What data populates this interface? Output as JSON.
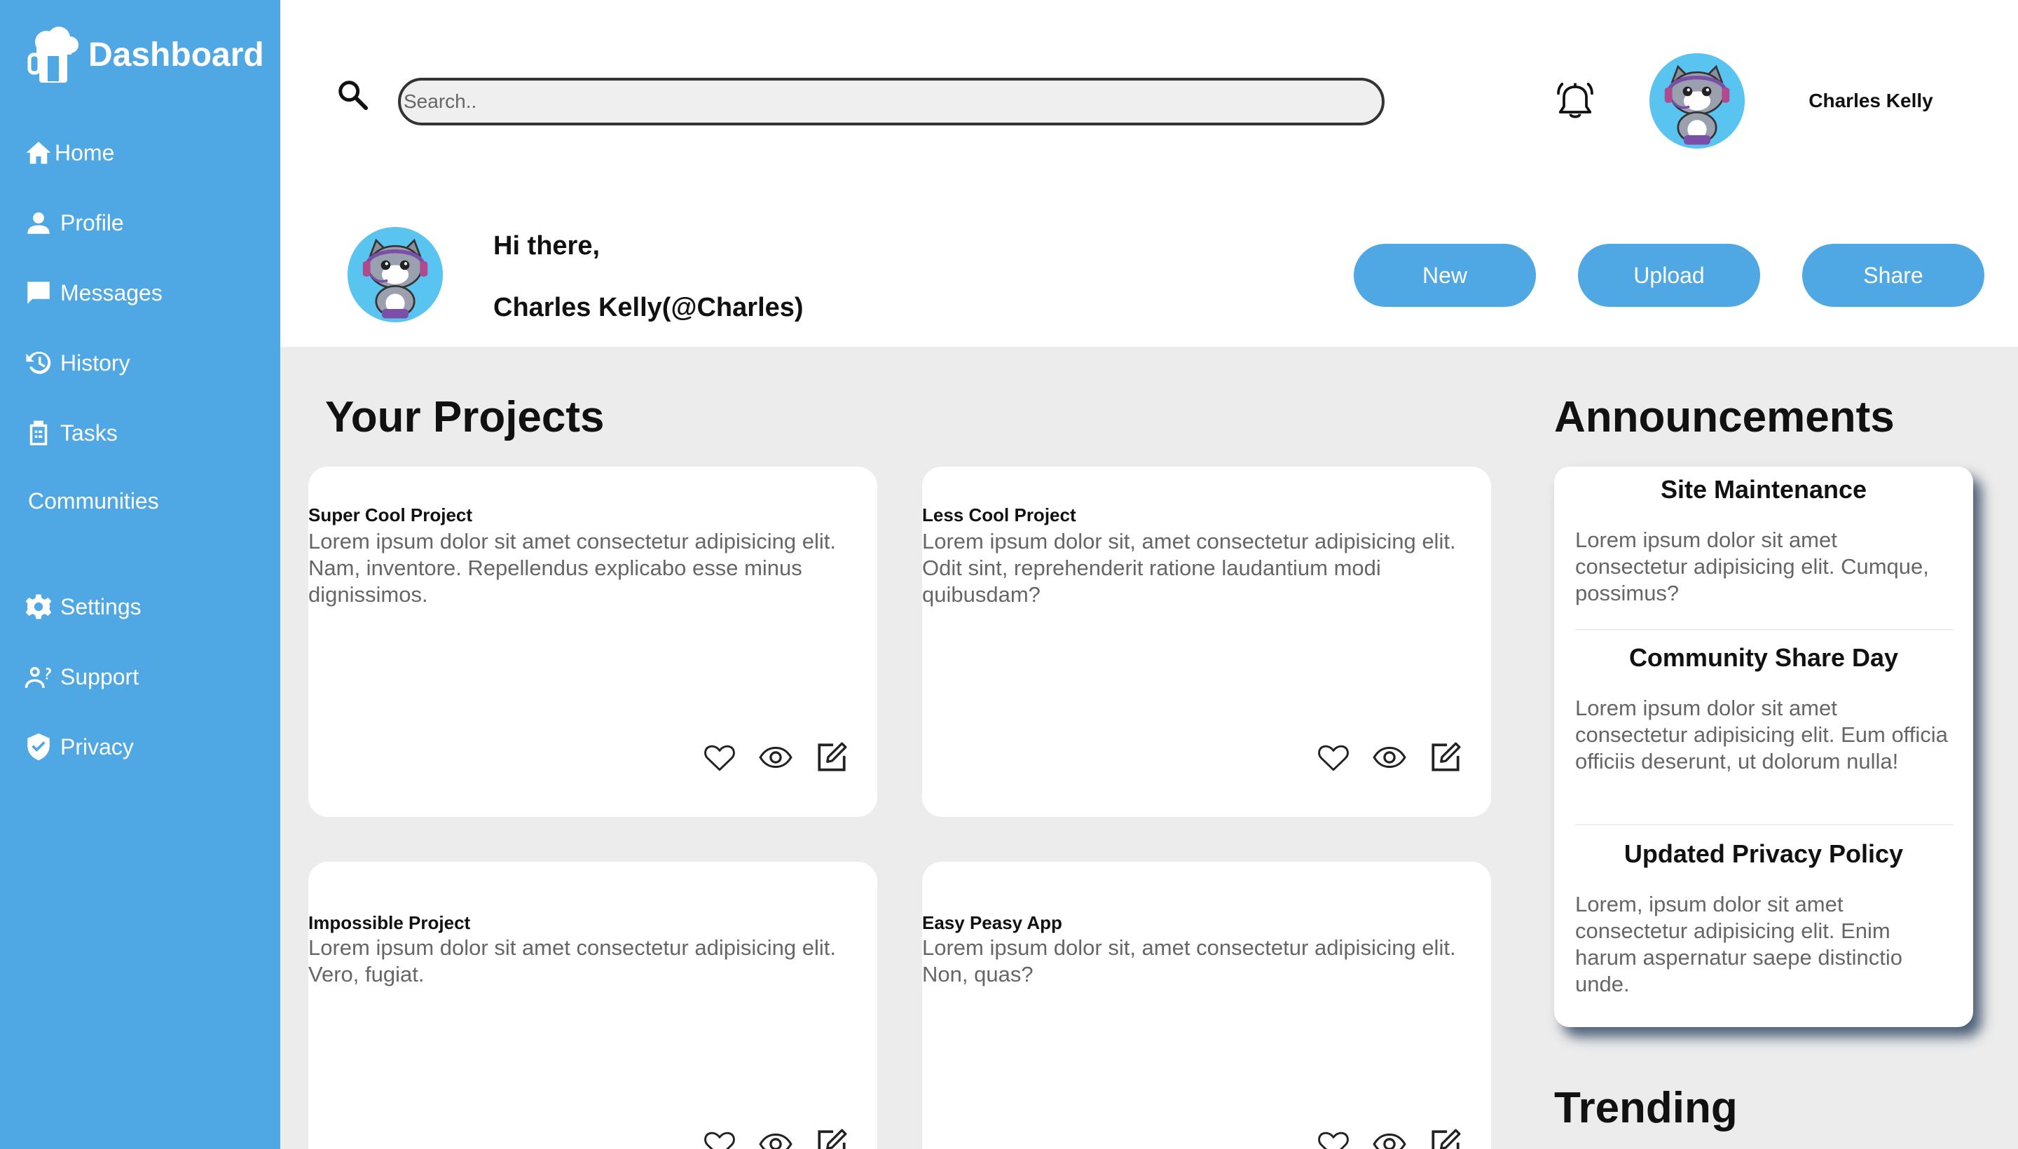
{
  "sidebar": {
    "brand": "Dashboard",
    "items": [
      {
        "label": "Home"
      },
      {
        "label": "Profile"
      },
      {
        "label": "Messages"
      },
      {
        "label": "History"
      },
      {
        "label": "Tasks"
      },
      {
        "label": "Communities"
      },
      {
        "label": "Settings"
      },
      {
        "label": "Support"
      },
      {
        "label": "Privacy"
      }
    ]
  },
  "header": {
    "search_placeholder": "Search..",
    "username": "Charles Kelly",
    "greeting": "Hi there,",
    "handle": "Charles Kelly(@Charles)",
    "buttons": {
      "new": "New",
      "upload": "Upload",
      "share": "Share"
    }
  },
  "projects": {
    "title": "Your Projects",
    "items": [
      {
        "title": "Super Cool Project",
        "body": "Lorem ipsum dolor sit amet consectetur adipisicing elit. Nam, inventore. Repellendus explicabo esse minus dignissimos."
      },
      {
        "title": "Less Cool Project",
        "body": "Lorem ipsum dolor sit, amet consectetur adipisicing elit. Odit sint, reprehenderit ratione laudantium modi quibusdam?"
      },
      {
        "title": "Impossible Project",
        "body": "Lorem ipsum dolor sit amet consectetur adipisicing elit. Vero, fugiat."
      },
      {
        "title": "Easy Peasy App",
        "body": "Lorem ipsum dolor sit, amet consectetur adipisicing elit. Non, quas?"
      }
    ]
  },
  "announcements": {
    "title": "Announcements",
    "items": [
      {
        "title": "Site Maintenance",
        "body": "Lorem ipsum dolor sit amet consectetur adipisicing elit. Cumque, possimus?"
      },
      {
        "title": "Community Share Day",
        "body": "Lorem ipsum dolor sit amet consectetur adipisicing elit. Eum officia officiis deserunt, ut dolorum nulla!"
      },
      {
        "title": "Updated Privacy Policy",
        "body": "Lorem, ipsum dolor sit amet consectetur adipisicing elit. Enim harum aspernatur saepe distinctio unde."
      }
    ]
  },
  "trending": {
    "title": "Trending"
  },
  "colors": {
    "accent": "#4fa7e3",
    "background": "#ececec",
    "card": "#ffffff"
  }
}
